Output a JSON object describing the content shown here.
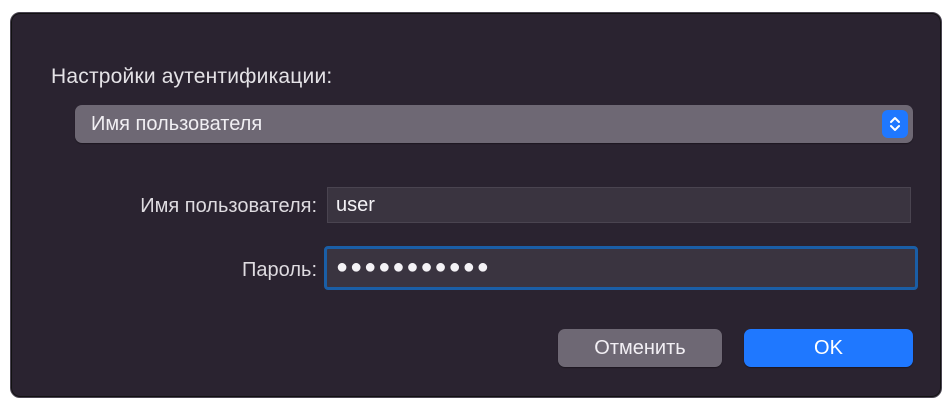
{
  "dialog": {
    "auth_settings_label": "Настройки аутентификации:",
    "auth_method": {
      "selected": "Имя пользователя"
    },
    "username": {
      "label": "Имя пользователя:",
      "value": "user"
    },
    "password": {
      "label": "Пароль:",
      "masked_value": "●●●●●●●●●●●"
    },
    "buttons": {
      "cancel": "Отменить",
      "ok": "OK"
    }
  },
  "colors": {
    "accent": "#1f78ff",
    "dialog_bg": "#2a2330",
    "focus_ring": "#1a5ea6"
  },
  "icons": {
    "popup": "chevron-up-down-icon"
  }
}
